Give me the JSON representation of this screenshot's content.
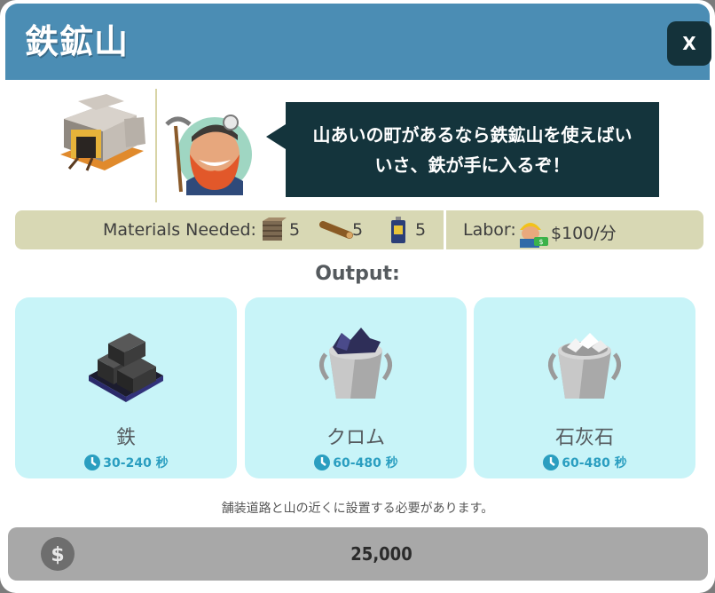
{
  "dialog": {
    "title": "鉄鉱山",
    "close_label": "X"
  },
  "hero": {
    "building_icon": "mine-building-icon",
    "avatar_icon": "miner-character-icon",
    "speech_line1": "山あいの町があるなら鉄鉱山を使えばい",
    "speech_line2": "いさ、鉄が手に入るぞ！"
  },
  "materials": {
    "label": "Materials Needed:",
    "items": [
      {
        "icon": "planks-icon",
        "amount": "5"
      },
      {
        "icon": "log-icon",
        "amount": "5"
      },
      {
        "icon": "battery-icon",
        "amount": "5"
      }
    ],
    "labor_label": "Labor:",
    "labor_icon": "worker-cash-icon",
    "labor_cost": "$100/分"
  },
  "output": {
    "title": "Output:",
    "cards": [
      {
        "name": "鉄",
        "time": "30-240 秒",
        "icon": "iron-ingot-icon"
      },
      {
        "name": "クロム",
        "time": "60-480 秒",
        "icon": "chromium-bucket-icon"
      },
      {
        "name": "石灰石",
        "time": "60-480 秒",
        "icon": "limestone-bucket-icon"
      }
    ]
  },
  "note": "舗装道路と山の近くに設置する必要があります。",
  "purchase": {
    "price": "25,000",
    "icon": "dollar-coin-icon"
  },
  "colors": {
    "header": "#4b8db4",
    "speech_bg": "#14343c",
    "card_bg": "#c8f4f8",
    "time_text": "#2a9ec0",
    "materials_bg": "#d8d8b4"
  }
}
